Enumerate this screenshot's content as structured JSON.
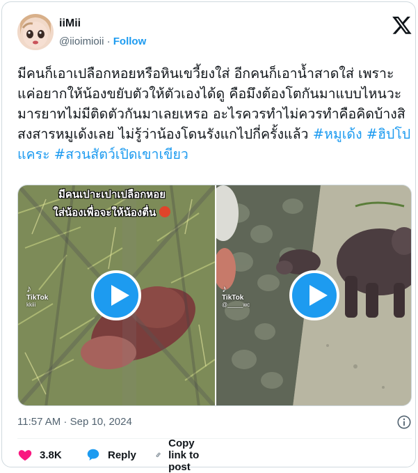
{
  "author": {
    "display_name": "iiMii",
    "handle": "@iioimioii",
    "separator": "·",
    "follow_label": "Follow"
  },
  "tweet": {
    "text_parts": [
      "มีคนก็เอาเปลือกหอยหรือหินเขวี้ยงใส่ อีกคนก็เอาน้ำสาดใส่ เพราะแค่อยากให้น้องขยับตัวให้ตัวเองได้ดู คือมึงต้องโตกันมาแบบไหนวะ มารยาทไม่มีติดตัวกันมาเลยเหรอ อะไรควรทำไม่ควรทำคือคิดบ้างสิ สงสารหมูเด้งเลย ไม่รู้ว่าน้องโดนรังแกไปกี่ครั้งแล้ว "
    ],
    "hashtags": [
      "#หมูเด้ง",
      "#ฮิปโปแคระ",
      "#สวนสัตว์เปิดเขาเขียว"
    ]
  },
  "media": {
    "video_left": {
      "caption_line1": "มีคนเปาะเปาเปลือกหอย",
      "caption_line2": "ใส่น้องเพื่อจะให้น้องตื่น",
      "watermark": "TikTok",
      "watermark_user": "kkiii"
    },
    "video_right": {
      "watermark": "TikTok",
      "watermark_user": "@_____wc"
    }
  },
  "meta": {
    "timestamp": "11:57 AM · Sep 10, 2024"
  },
  "actions": {
    "like_count": "3.8K",
    "reply_label": "Reply",
    "copy_link_label": "Copy link to post"
  },
  "colors": {
    "accent": "#1d9bf0",
    "like": "#f91880",
    "text": "#0f1419",
    "muted": "#536471"
  }
}
